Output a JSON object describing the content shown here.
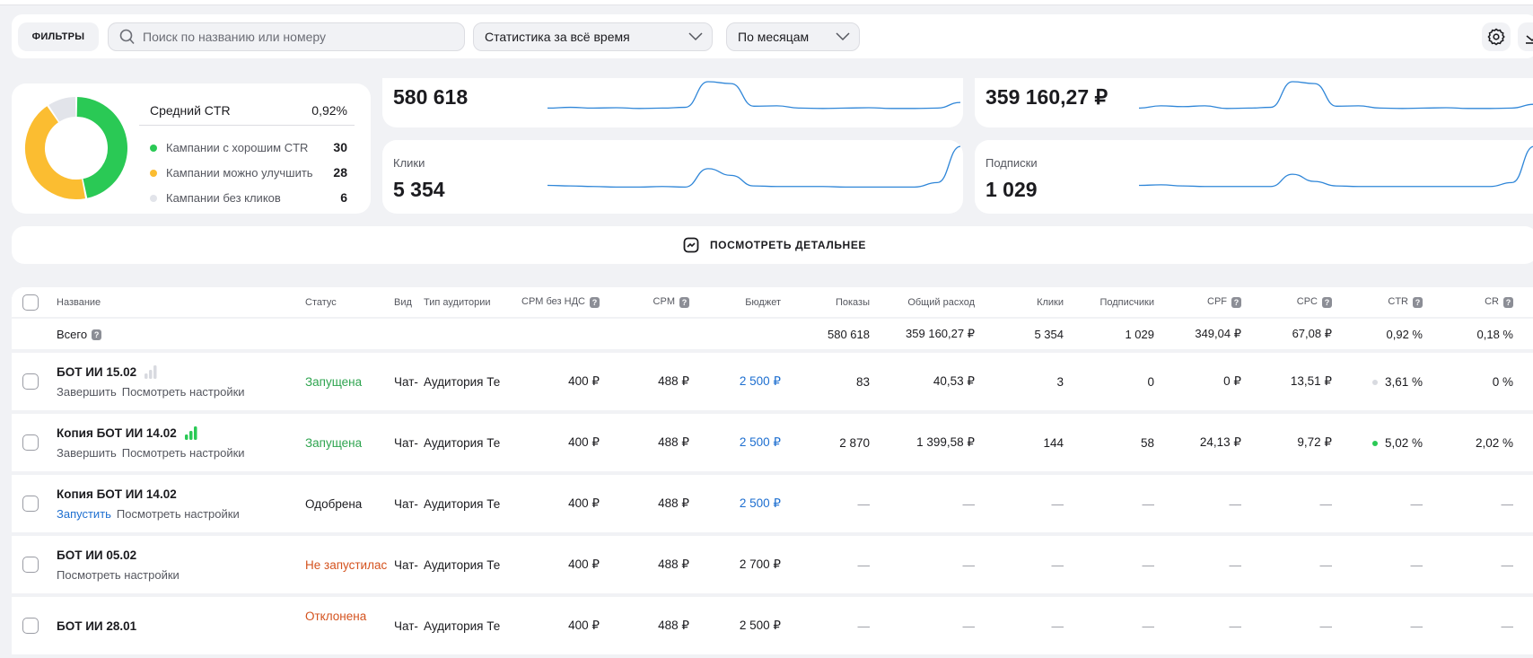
{
  "toolbar": {
    "filters_label": "ФИЛЬТРЫ",
    "search_placeholder": "Поиск по названию или номеру",
    "period_select": "Статистика за всё время",
    "grouping_select": "По месяцам",
    "icons": [
      "search-icon",
      "chevron-down-icon",
      "gear-icon",
      "download-icon"
    ]
  },
  "ctr_summary": {
    "title": "Средний CTR",
    "value": "0,92%",
    "colors": {
      "good": "#2ac955",
      "improve": "#fbbd31",
      "noclicks": "#e2e4ea"
    },
    "items": [
      {
        "label": "Кампании с хорошим CTR",
        "count": 30
      },
      {
        "label": "Кампании можно улучшить",
        "count": 28
      },
      {
        "label": "Кампании без кликов",
        "count": 6
      }
    ]
  },
  "metrics": [
    {
      "label": "",
      "value": "580 618",
      "spark": [
        3,
        3.2,
        3,
        3.1,
        2.9,
        3,
        3.2,
        10,
        9.5,
        3.5,
        3.6,
        3,
        2.9,
        3,
        3.1,
        2.9,
        2.9,
        3,
        4.5
      ]
    },
    {
      "label": "",
      "value": "359 160,27 ₽",
      "spark": [
        3,
        3.6,
        3.4,
        3.6,
        2.9,
        3,
        3.2,
        10,
        9.5,
        3.5,
        3.6,
        3,
        2.9,
        3,
        3.1,
        2.9,
        2.9,
        3,
        4
      ]
    },
    {
      "label": "Клики",
      "value": "5 354",
      "spark": [
        2.5,
        2.4,
        2.3,
        2.2,
        2.2,
        2.3,
        2.2,
        5.5,
        4.3,
        2.4,
        2.3,
        2.3,
        2.3,
        2.2,
        2.2,
        2.2,
        2.2,
        3,
        9.5
      ]
    },
    {
      "label": "Подписки",
      "value": "1 029",
      "spark": [
        2.5,
        2.6,
        2.4,
        2.3,
        2.3,
        2.3,
        2.3,
        4.5,
        3.2,
        2.4,
        2.3,
        2.3,
        2.3,
        2.3,
        2.3,
        2.3,
        2.3,
        3,
        9.5
      ]
    }
  ],
  "details_button": "ПОСМОТРЕТЬ ДЕТАЛЬНЕЕ",
  "accent": "#1e6fd0",
  "table": {
    "columns": [
      "Название",
      "Статус",
      "Вид",
      "Тип аудитории",
      "CPM без НДС",
      "CPM",
      "Бюджет",
      "Показы",
      "Общий расход",
      "Клики",
      "Подписчики",
      "CPF",
      "CPC",
      "CTR",
      "CR"
    ],
    "help_columns": [
      "CPM без НДС",
      "CPM",
      "CPF",
      "CPC",
      "CTR",
      "CR"
    ],
    "total": {
      "label": "Всего",
      "shows": "580 618",
      "spend": "359 160,27 ₽",
      "clicks": "5 354",
      "subs": "1 029",
      "cpf": "349,04 ₽",
      "cpc": "67,08 ₽",
      "ctr": "0,92 %",
      "cr": "0,18 %"
    },
    "rows": [
      {
        "name": "БОТ ИИ 15.02",
        "signal": "weak",
        "actions": [
          "Завершить",
          "Посмотреть настройки"
        ],
        "status": "Запущена",
        "status_color": "#2ea44f",
        "vid": "Чат-",
        "audience": "Аудитория Те",
        "cpm_no_vat": "400 ₽",
        "cpm": "488 ₽",
        "budget": "2 500 ₽",
        "budget_link": true,
        "shows": "83",
        "spend": "40,53 ₽",
        "clicks": "3",
        "subs": "0",
        "cpf": "0 ₽",
        "cpc": "13,51 ₽",
        "ctr": "3,61 %",
        "ctr_dot": "#d8dae0",
        "cr": "0 %"
      },
      {
        "name": "Копия БОТ ИИ 14.02",
        "signal": "strong",
        "actions": [
          "Завершить",
          "Посмотреть настройки"
        ],
        "status": "Запущена",
        "status_color": "#2ea44f",
        "vid": "Чат-",
        "audience": "Аудитория Те",
        "cpm_no_vat": "400 ₽",
        "cpm": "488 ₽",
        "budget": "2 500 ₽",
        "budget_link": true,
        "shows": "2 870",
        "spend": "1 399,58 ₽",
        "clicks": "144",
        "subs": "58",
        "cpf": "24,13 ₽",
        "cpc": "9,72 ₽",
        "ctr": "5,02 %",
        "ctr_dot": "#2ac955",
        "cr": "2,02 %"
      },
      {
        "name": "Копия БОТ ИИ 14.02",
        "actions": [
          "Запустить",
          "Посмотреть настройки"
        ],
        "action_link": 0,
        "status": "Одобрена",
        "status_color": "#1b1b1f",
        "vid": "Чат-",
        "audience": "Аудитория Те",
        "cpm_no_vat": "400 ₽",
        "cpm": "488 ₽",
        "budget": "2 500 ₽",
        "budget_link": true,
        "shows": "—",
        "spend": "—",
        "clicks": "—",
        "subs": "—",
        "cpf": "—",
        "cpc": "—",
        "ctr": "—",
        "cr": "—"
      },
      {
        "name": "БОТ ИИ 05.02",
        "actions": [
          "Посмотреть настройки"
        ],
        "status": "Не запустилас",
        "status_color": "#d4521e",
        "vid": "Чат-",
        "audience": "Аудитория Те",
        "cpm_no_vat": "400 ₽",
        "cpm": "488 ₽",
        "budget": "2 700 ₽",
        "budget_link": false,
        "shows": "—",
        "spend": "—",
        "clicks": "—",
        "subs": "—",
        "cpf": "—",
        "cpc": "—",
        "ctr": "—",
        "cr": "—"
      },
      {
        "name": "БОТ ИИ 28.01",
        "actions": [],
        "status": "Отклонена",
        "status_color": "#d4521e",
        "vid": "Чат-",
        "audience": "Аудитория Те",
        "cpm_no_vat": "400 ₽",
        "cpm": "488 ₽",
        "budget": "2 500 ₽",
        "budget_link": false,
        "shows": "—",
        "spend": "—",
        "clicks": "—",
        "subs": "—",
        "cpf": "—",
        "cpc": "—",
        "ctr": "—",
        "cr": "—"
      }
    ]
  }
}
